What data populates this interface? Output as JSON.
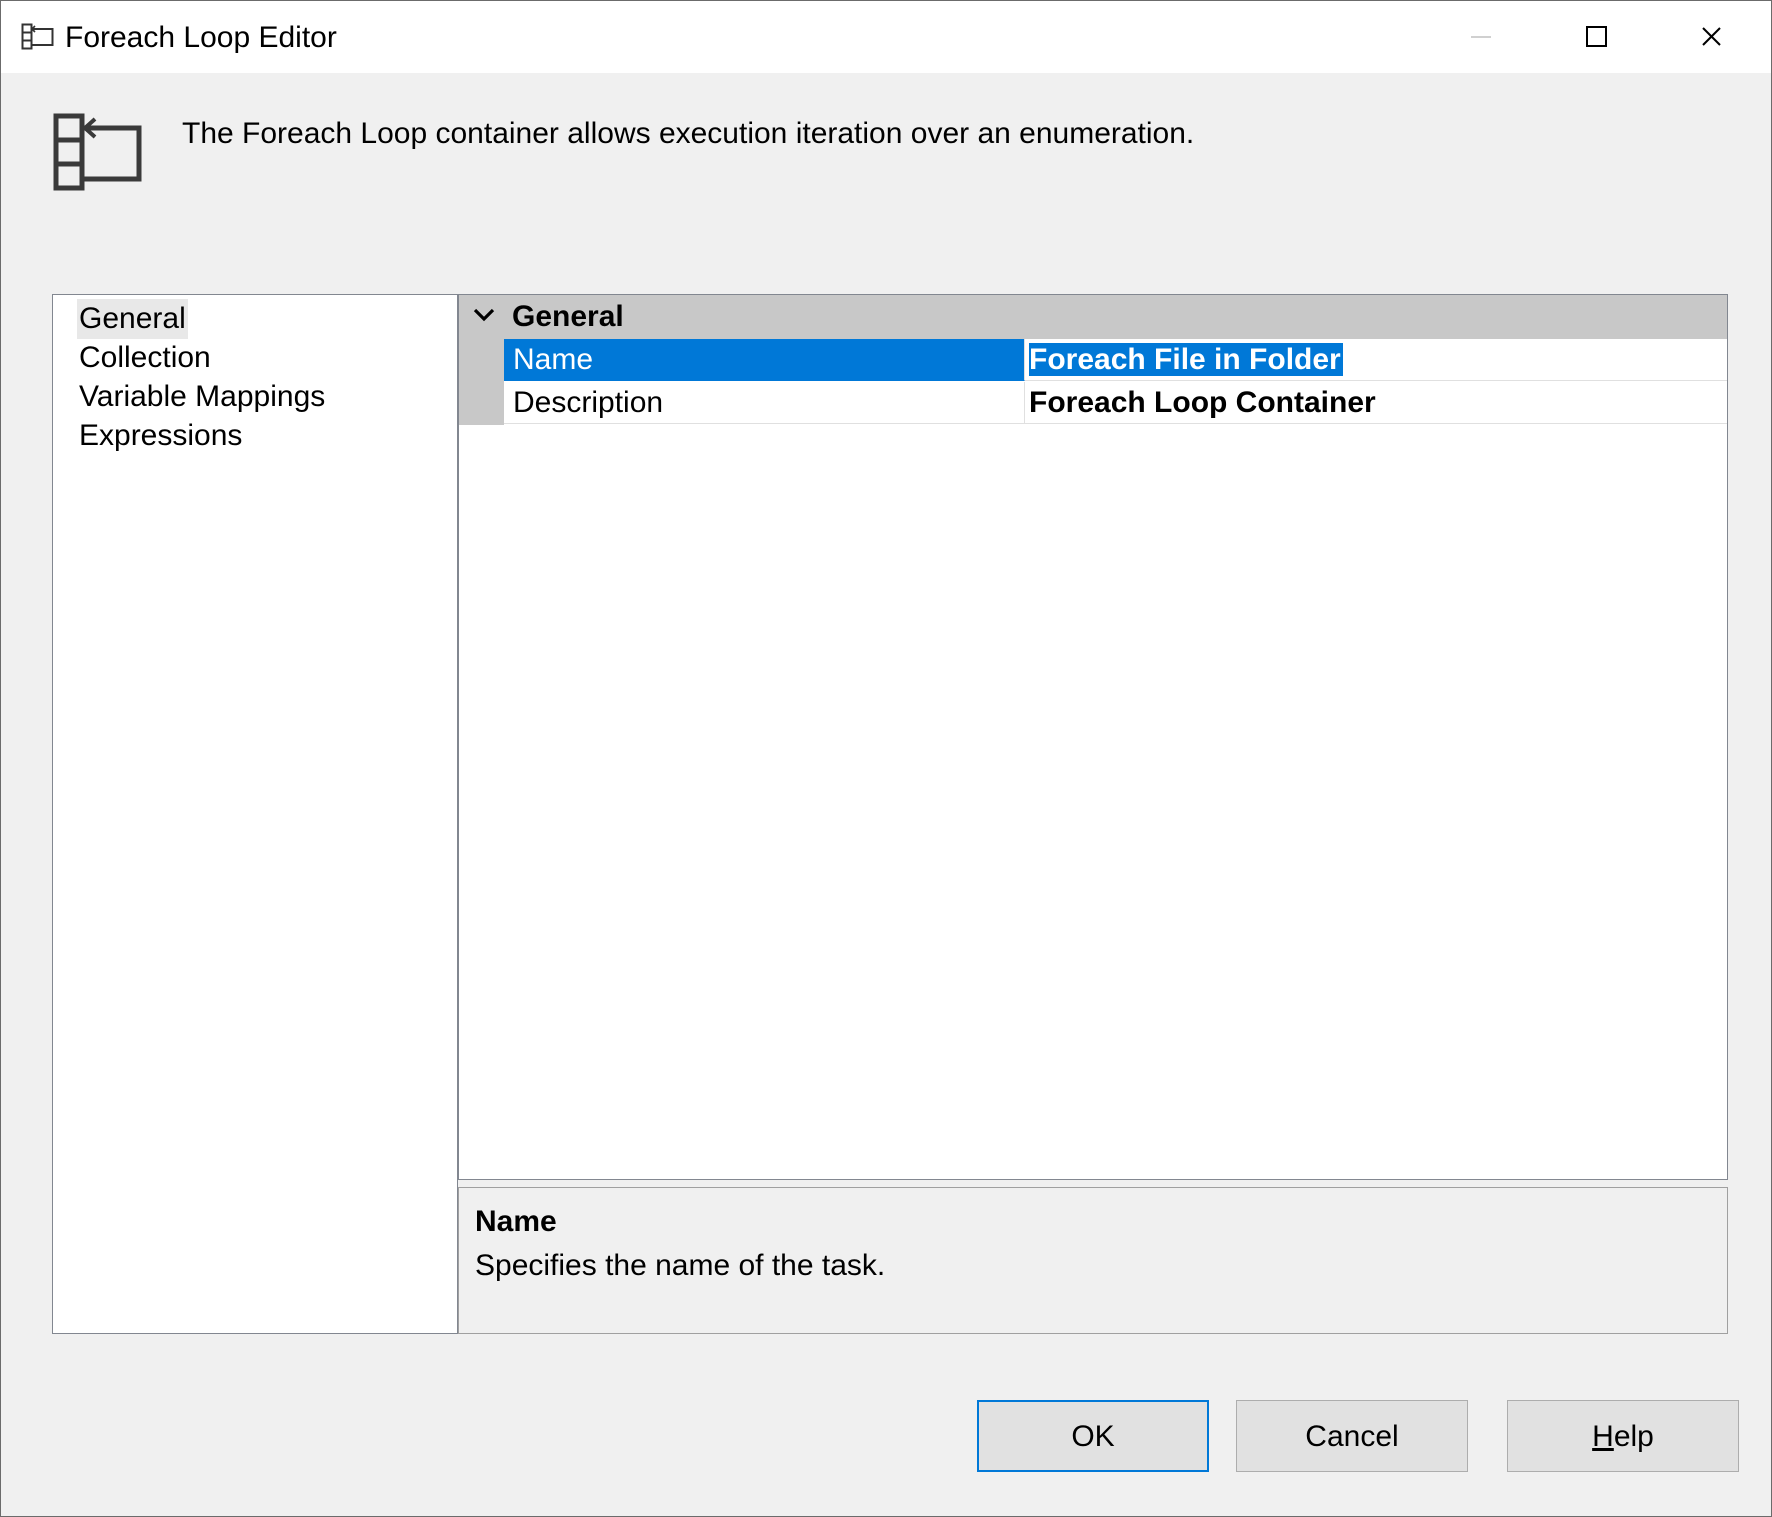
{
  "window": {
    "title": "Foreach Loop Editor",
    "icon": "foreach-loop-icon"
  },
  "header": {
    "icon": "foreach-loop-large-icon",
    "description": "The Foreach Loop container allows execution iteration over an enumeration."
  },
  "nav": {
    "items": [
      {
        "label": "General",
        "selected": true
      },
      {
        "label": "Collection",
        "selected": false
      },
      {
        "label": "Variable Mappings",
        "selected": false
      },
      {
        "label": "Expressions",
        "selected": false
      }
    ]
  },
  "property_grid": {
    "category": "General",
    "rows": [
      {
        "name": "Name",
        "value": "Foreach File in Folder",
        "selected": true
      },
      {
        "name": "Description",
        "value": "Foreach Loop Container",
        "selected": false
      }
    ]
  },
  "description_pane": {
    "title": "Name",
    "text": "Specifies the name of the task."
  },
  "buttons": {
    "ok": "OK",
    "cancel": "Cancel",
    "help_mnemonic": "H",
    "help_rest": "elp"
  },
  "colors": {
    "selection": "#0078d7",
    "category_bg": "#c8c8c8",
    "dialog_bg": "#f0f0f0"
  }
}
